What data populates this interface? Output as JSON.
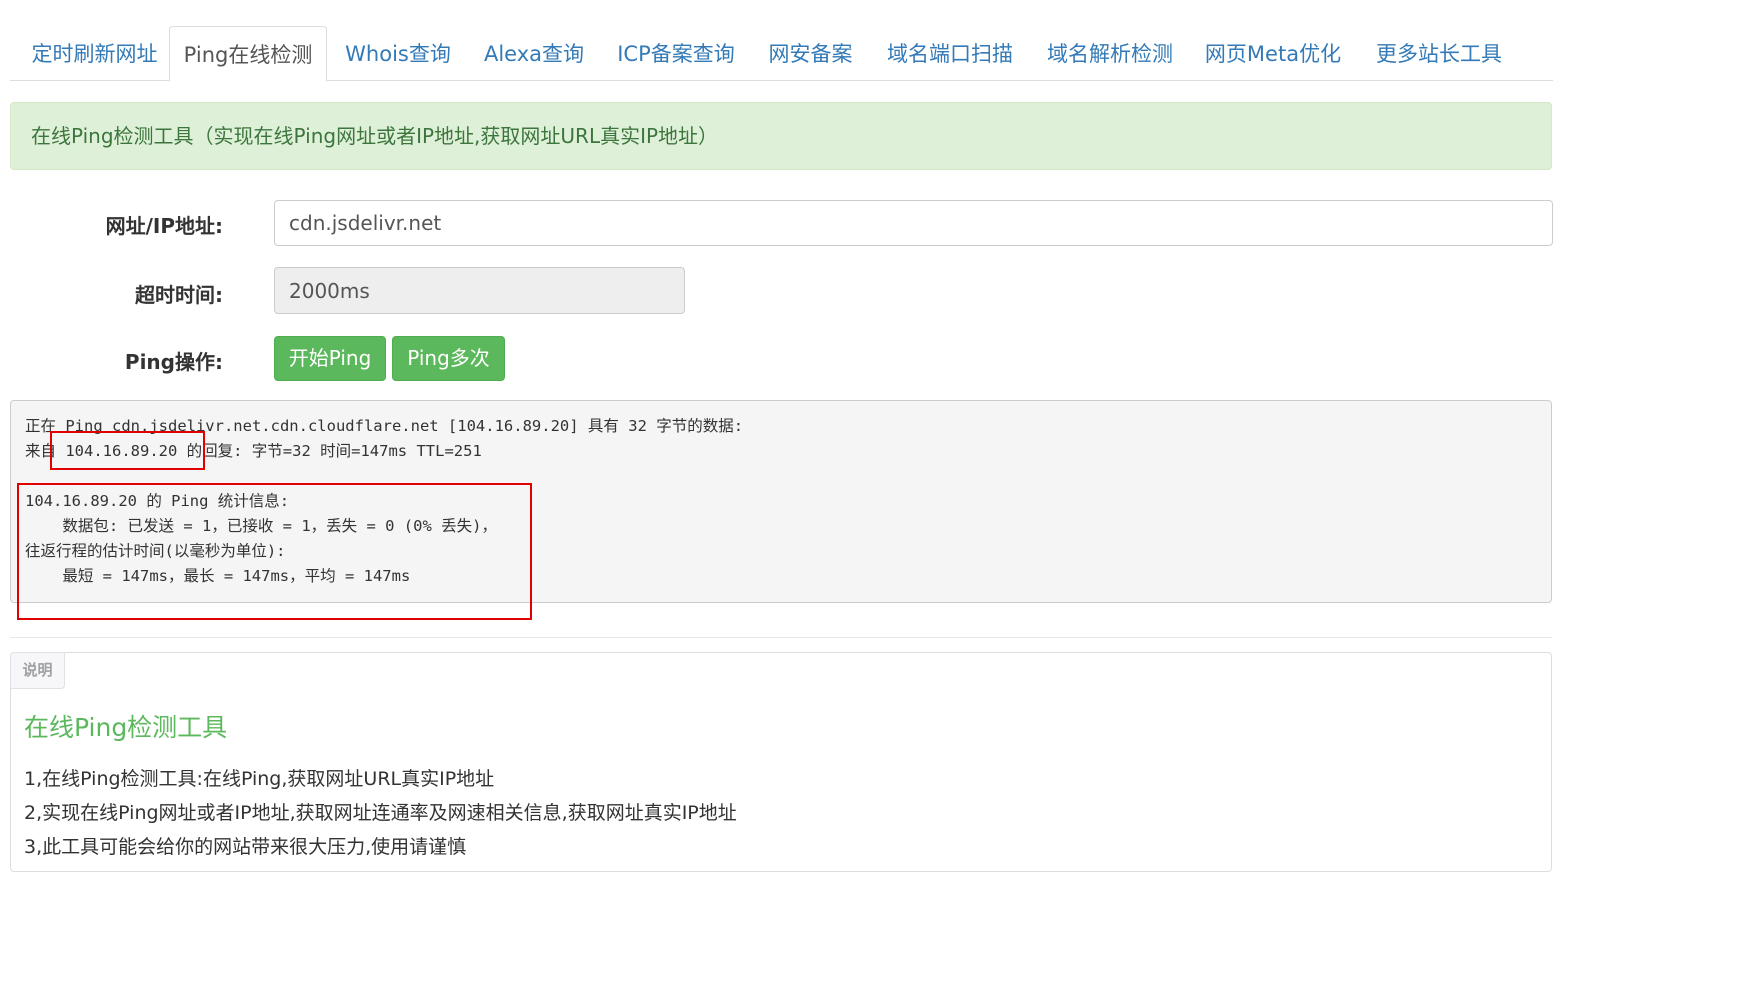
{
  "tabs": [
    {
      "label": "定时刷新网址"
    },
    {
      "label": "Ping在线检测",
      "active": true
    },
    {
      "label": "Whois查询"
    },
    {
      "label": "Alexa查询"
    },
    {
      "label": "ICP备案查询"
    },
    {
      "label": "网安备案"
    },
    {
      "label": "域名端口扫描"
    },
    {
      "label": "域名解析检测"
    },
    {
      "label": "网页Meta优化"
    },
    {
      "label": "更多站长工具"
    }
  ],
  "banner": {
    "text": "在线Ping检测工具（实现在线Ping网址或者IP地址,获取网址URL真实IP地址）"
  },
  "form": {
    "url_label": "网址/IP地址:",
    "url_value": "cdn.jsdelivr.net",
    "timeout_label": "超时时间:",
    "timeout_value": "2000ms",
    "action_label": "Ping操作:",
    "start_button": "开始Ping",
    "multi_button": "Ping多次"
  },
  "console": {
    "lines": [
      "正在 Ping cdn.jsdelivr.net.cdn.cloudflare.net [104.16.89.20] 具有 32 字节的数据:",
      "来自 104.16.89.20 的回复: 字节=32 时间=147ms TTL=251",
      "",
      "104.16.89.20 的 Ping 统计信息:",
      "    数据包: 已发送 = 1，已接收 = 1，丢失 = 0 (0% 丢失)，",
      "往返行程的估计时间(以毫秒为单位):",
      "    最短 = 147ms，最长 = 147ms，平均 = 147ms"
    ]
  },
  "notes": {
    "tag": "说明",
    "title": "在线Ping检测工具",
    "items": [
      "1,在线Ping检测工具:在线Ping,获取网址URL真实IP地址",
      "2,实现在线Ping网址或者IP地址,获取网址连通率及网速相关信息,获取网址真实IP地址",
      "3,此工具可能会给你的网站带来很大压力,使用请谨慎"
    ]
  },
  "colors": {
    "link": "#337ab7",
    "success_bg": "#dff0d8",
    "success_text": "#3c763d",
    "button_green": "#5cb85c",
    "highlight_red": "#e00000"
  }
}
